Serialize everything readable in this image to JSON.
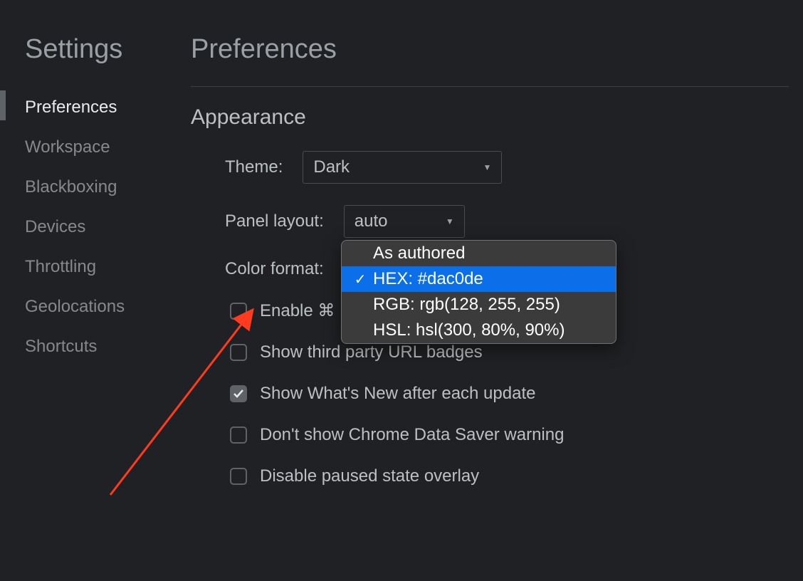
{
  "sidebar": {
    "title": "Settings",
    "items": [
      {
        "label": "Preferences",
        "active": true
      },
      {
        "label": "Workspace",
        "active": false
      },
      {
        "label": "Blackboxing",
        "active": false
      },
      {
        "label": "Devices",
        "active": false
      },
      {
        "label": "Throttling",
        "active": false
      },
      {
        "label": "Geolocations",
        "active": false
      },
      {
        "label": "Shortcuts",
        "active": false
      }
    ]
  },
  "main": {
    "title": "Preferences",
    "section": "Appearance",
    "theme": {
      "label": "Theme:",
      "value": "Dark"
    },
    "panel_layout": {
      "label": "Panel layout:",
      "value": "auto"
    },
    "color_format": {
      "label": "Color format:",
      "options": [
        {
          "label": "As authored",
          "selected": false
        },
        {
          "label": "HEX: #dac0de",
          "selected": true
        },
        {
          "label": "RGB: rgb(128, 255, 255)",
          "selected": false
        },
        {
          "label": "HSL: hsl(300, 80%, 90%)",
          "selected": false
        }
      ]
    },
    "checkboxes": [
      {
        "label": "Enable ⌘",
        "checked": false
      },
      {
        "label": "Show third party URL badges",
        "checked": false
      },
      {
        "label": "Show What's New after each update",
        "checked": true
      },
      {
        "label": "Don't show Chrome Data Saver warning",
        "checked": false
      },
      {
        "label": "Disable paused state overlay",
        "checked": false
      }
    ]
  }
}
